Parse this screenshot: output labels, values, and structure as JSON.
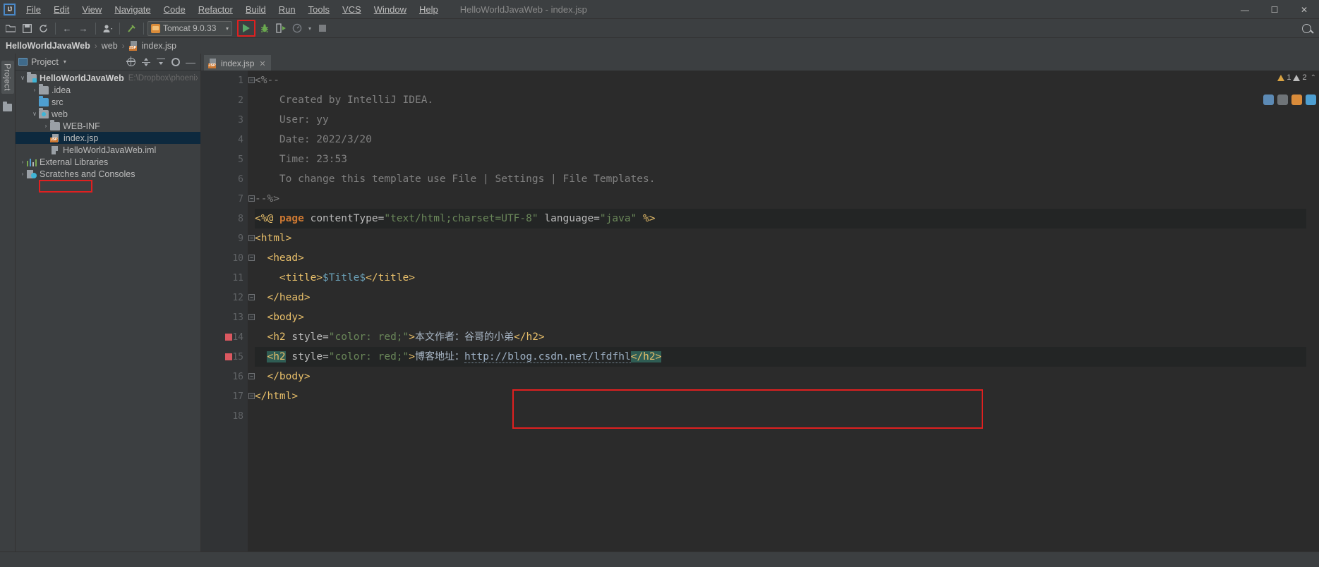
{
  "window": {
    "title": "HelloWorldJavaWeb - index.jsp",
    "logo": "IJ",
    "minimize": "—",
    "maximize": "☐",
    "close": "✕"
  },
  "menu": [
    {
      "label": "File"
    },
    {
      "label": "Edit"
    },
    {
      "label": "View"
    },
    {
      "label": "Navigate"
    },
    {
      "label": "Code"
    },
    {
      "label": "Refactor"
    },
    {
      "label": "Build"
    },
    {
      "label": "Run"
    },
    {
      "label": "Tools"
    },
    {
      "label": "VCS"
    },
    {
      "label": "Window"
    },
    {
      "label": "Help"
    }
  ],
  "toolbar": {
    "open_icon": "open-folder-icon",
    "save_icon": "save-icon",
    "sync_icon": "sync-icon",
    "back_icon": "←",
    "forward_icon": "→",
    "profile_icon": "user-icon",
    "build_icon": "hammer-icon",
    "run_config": "Tomcat 9.0.33",
    "run_config_arrow": "▾",
    "run_label": "run-button",
    "debug_label": "debug-button",
    "coverage_label": "run-with-coverage-button",
    "profile_label": "profiler-button",
    "stop_label": "stop-button",
    "search_label": "search-everywhere",
    "highlight_color": "#e02020"
  },
  "breadcrumb": {
    "project": "HelloWorldJavaWeb",
    "folder": "web",
    "file": "index.jsp",
    "separator": "›",
    "badge": "JSP"
  },
  "project_panel": {
    "title": "Project",
    "caret": "▾",
    "tool_window_label": "Project",
    "actions": [
      "locate-icon",
      "expand-all-icon",
      "collapse-all-icon",
      "settings-gear-icon",
      "hide-icon"
    ],
    "tree": [
      {
        "label": "HelloWorldJavaWeb",
        "path": "E:\\Dropbox\\phoenix\\Test",
        "twisty": "∨",
        "icon": "module-folder-icon",
        "indent": 0,
        "bold": true,
        "selected": false
      },
      {
        "label": ".idea",
        "path": "",
        "twisty": "›",
        "icon": "folder-icon",
        "indent": 1,
        "bold": false,
        "selected": false
      },
      {
        "label": "src",
        "path": "",
        "twisty": "",
        "icon": "source-folder-icon",
        "indent": 1,
        "bold": false,
        "selected": false
      },
      {
        "label": "web",
        "path": "",
        "twisty": "∨",
        "icon": "web-resource-folder-icon",
        "indent": 1,
        "bold": false,
        "selected": false
      },
      {
        "label": "WEB-INF",
        "path": "",
        "twisty": "›",
        "icon": "folder-icon",
        "indent": 2,
        "bold": false,
        "selected": false
      },
      {
        "label": "index.jsp",
        "path": "",
        "twisty": "",
        "icon": "jsp-file-icon",
        "indent": 2,
        "bold": false,
        "selected": true
      },
      {
        "label": "HelloWorldJavaWeb.iml",
        "path": "",
        "twisty": "",
        "icon": "iml-file-icon",
        "indent": 2,
        "bold": false,
        "selected": false
      },
      {
        "label": "External Libraries",
        "path": "",
        "twisty": "›",
        "icon": "libraries-icon",
        "indent": 0,
        "bold": false,
        "selected": false
      },
      {
        "label": "Scratches and Consoles",
        "path": "",
        "twisty": "›",
        "icon": "scratches-icon",
        "indent": 0,
        "bold": false,
        "selected": false
      }
    ],
    "highlight_color": "#e02020"
  },
  "editor": {
    "tab": {
      "label": "index.jsp",
      "badge": "JSP",
      "close": "✕"
    },
    "warnings": {
      "warning_count": "1",
      "weak_warning_count": "2",
      "chevron": "⌃"
    },
    "highlight_color": "#e02020",
    "lines": [
      {
        "num": "1",
        "breakpoint": false,
        "fold": "−",
        "text": "<%--"
      },
      {
        "num": "2",
        "breakpoint": false,
        "fold": "",
        "text": "  Created by IntelliJ IDEA."
      },
      {
        "num": "3",
        "breakpoint": false,
        "fold": "",
        "text": "  User: yy"
      },
      {
        "num": "4",
        "breakpoint": false,
        "fold": "",
        "text": "  Date: 2022/3/20"
      },
      {
        "num": "5",
        "breakpoint": false,
        "fold": "",
        "text": "  Time: 23:53"
      },
      {
        "num": "6",
        "breakpoint": false,
        "fold": "",
        "text": "  To change this template use File | Settings | File Templates."
      },
      {
        "num": "7",
        "breakpoint": false,
        "fold": "−",
        "text": "--%>"
      },
      {
        "num": "8",
        "breakpoint": false,
        "fold": "",
        "text": "<%@ page contentType=\"text/html;charset=UTF-8\" language=\"java\" %>"
      },
      {
        "num": "9",
        "breakpoint": false,
        "fold": "−",
        "text": "<html>"
      },
      {
        "num": "10",
        "breakpoint": false,
        "fold": "−",
        "text": "  <head>"
      },
      {
        "num": "11",
        "breakpoint": false,
        "fold": "",
        "text": "    <title>$Title$</title>"
      },
      {
        "num": "12",
        "breakpoint": false,
        "fold": "−",
        "text": "  </head>"
      },
      {
        "num": "13",
        "breakpoint": false,
        "fold": "−",
        "text": "  <body>"
      },
      {
        "num": "14",
        "breakpoint": true,
        "fold": "",
        "text": "  <h2 style=\"color: red;\">本文作者：谷哥的小弟</h2>"
      },
      {
        "num": "15",
        "breakpoint": true,
        "fold": "",
        "text": "  <h2 style=\"color: red;\">博客地址：http://blog.csdn.net/lfdfhl</h2>"
      },
      {
        "num": "16",
        "breakpoint": false,
        "fold": "−",
        "text": "  </body>"
      },
      {
        "num": "17",
        "breakpoint": false,
        "fold": "−",
        "text": "</html>"
      },
      {
        "num": "18",
        "breakpoint": false,
        "fold": "",
        "text": ""
      }
    ],
    "code_tokens": {
      "l1": "<%--",
      "l2": "Created by IntelliJ IDEA.",
      "l3": "User: yy",
      "l4": "Date: 2022/3/20",
      "l5": "Time: 23:53",
      "l6": "To change this template use File | Settings | File Templates.",
      "l7": "--%>",
      "l8_open": "<%@",
      "l8_kw": "page",
      "l8_attr1": "contentType=",
      "l8_str1": "\"text/html;charset=UTF-8\"",
      "l8_attr2": "language=",
      "l8_str2": "\"java\"",
      "l8_close": "%>",
      "l9": "<html>",
      "l10": "<head>",
      "l11_open": "<title>",
      "l11_var": "$Title$",
      "l11_close": "</title>",
      "l12": "</head>",
      "l13": "<body>",
      "l14_tag": "<h2",
      "l14_attr": " style=",
      "l14_str": "\"color: red;\"",
      "l14_gt": ">",
      "l14_text": "本文作者：谷哥的小弟",
      "l14_end": "</h2>",
      "l15_tag": "<h2",
      "l15_attr": " style=",
      "l15_str": "\"color: red;\"",
      "l15_gt": ">",
      "l15_text": "博客地址：",
      "l15_url": "http://blog.csdn.net/lfdfhl",
      "l15_end": "</h2>",
      "l16": "</body>",
      "l17": "</html>"
    },
    "widgets": [
      "settings-widget",
      "inspections-widget",
      "warning-widget",
      "info-widget"
    ]
  }
}
